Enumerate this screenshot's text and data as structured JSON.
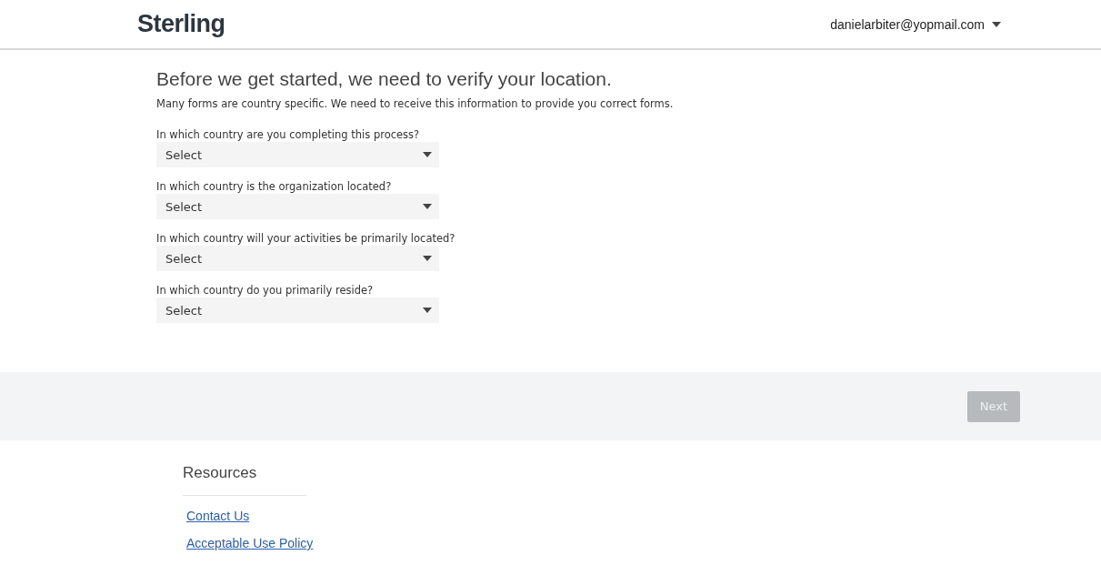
{
  "header": {
    "logo": "Sterling",
    "user_email": "danielarbiter@yopmail.com"
  },
  "heading": "Before we get started, we need to verify your location.",
  "intro": "Many forms are country specific. We need to receive this information to provide you correct forms.",
  "questions": [
    {
      "label": "In which country are you completing this process?",
      "placeholder": "Select"
    },
    {
      "label": "In which country is the organization located?",
      "placeholder": "Select"
    },
    {
      "label": "In which country will your activities be primarily located?",
      "placeholder": "Select"
    },
    {
      "label": "In which country do you primarily reside?",
      "placeholder": "Select"
    }
  ],
  "next_button": {
    "label": "Next",
    "disabled": true
  },
  "resources": {
    "title": "Resources",
    "links": [
      "Contact Us",
      "Acceptable Use Policy"
    ]
  }
}
